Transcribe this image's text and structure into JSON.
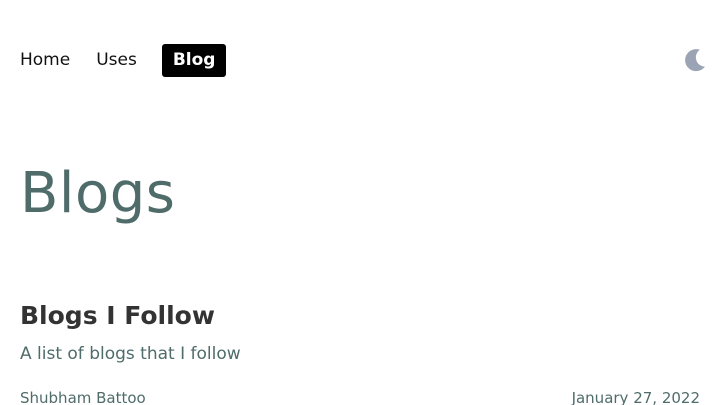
{
  "nav": {
    "items": [
      {
        "label": "Home",
        "active": false
      },
      {
        "label": "Uses",
        "active": false
      },
      {
        "label": "Blog",
        "active": true
      }
    ]
  },
  "theme_toggle": {
    "icon": "moon-icon",
    "color": "#9aa4b5"
  },
  "main": {
    "title": "Blogs",
    "posts": [
      {
        "title": "Blogs I Follow",
        "description": "A list of blogs that I follow",
        "author": "Shubham Battoo",
        "date": "January 27, 2022"
      }
    ]
  },
  "colors": {
    "accent": "#4f6c6a",
    "text": "#333333",
    "active_nav_bg": "#000000",
    "active_nav_text": "#ffffff"
  }
}
